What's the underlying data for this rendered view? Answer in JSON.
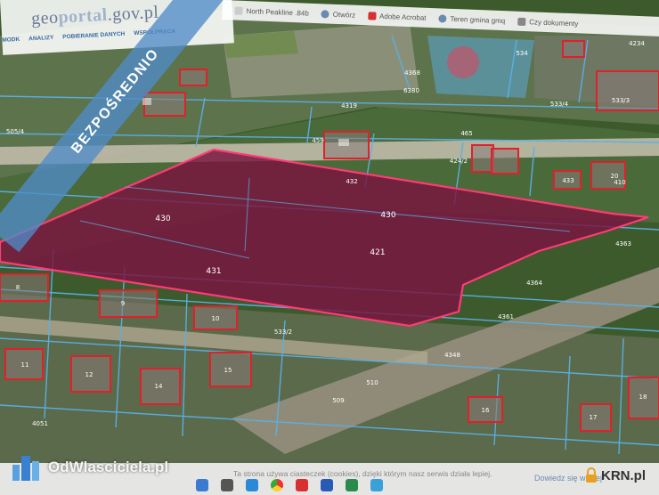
{
  "browser_toolbar": {
    "items": [
      "North Peakline .84b",
      "Otwórz",
      "Adobe Acrobat",
      "Teren gmina gmq",
      "Czy dokumenty"
    ]
  },
  "geoportal": {
    "logo_prefix": "geo",
    "logo_main": "portal",
    "logo_suffix": ".gov.pl",
    "menu": [
      "MODK",
      "ANALIZY",
      "POBIERANIE DANYCH",
      "WSPÓŁPRACA"
    ]
  },
  "banner": {
    "text": "BEZPOŚREDNIO"
  },
  "parcels": {
    "main_labels": [
      "430",
      "430",
      "421",
      "431"
    ],
    "other_labels": [
      "459",
      "432",
      "424/2",
      "433",
      "410",
      "465",
      "4368",
      "4319",
      "505/4",
      "534",
      "4234",
      "533/4",
      "533/3",
      "6380",
      "4364",
      "4363",
      "4361",
      "533/2",
      "4348",
      "510",
      "509",
      "4051"
    ],
    "building_labels": [
      "8",
      "9",
      "10",
      "11",
      "12",
      "14",
      "15",
      "16",
      "17",
      "18",
      "20"
    ]
  },
  "cookie_bar": {
    "text": "Ta strona używa ciasteczek (cookies), dzięki którym nasz serwis działa lepiej.",
    "more_link": "Dowiedz się więcej"
  },
  "watermarks": {
    "left": "OdWlasciciela.pl",
    "right": "KRN.pl"
  },
  "colors": {
    "parcel_fill": "#7a1440",
    "parcel_border": "#ff3b74",
    "building_outline": "#e0202a",
    "cadastral_line": "#5ab0e8",
    "banner": "#508cc8"
  }
}
